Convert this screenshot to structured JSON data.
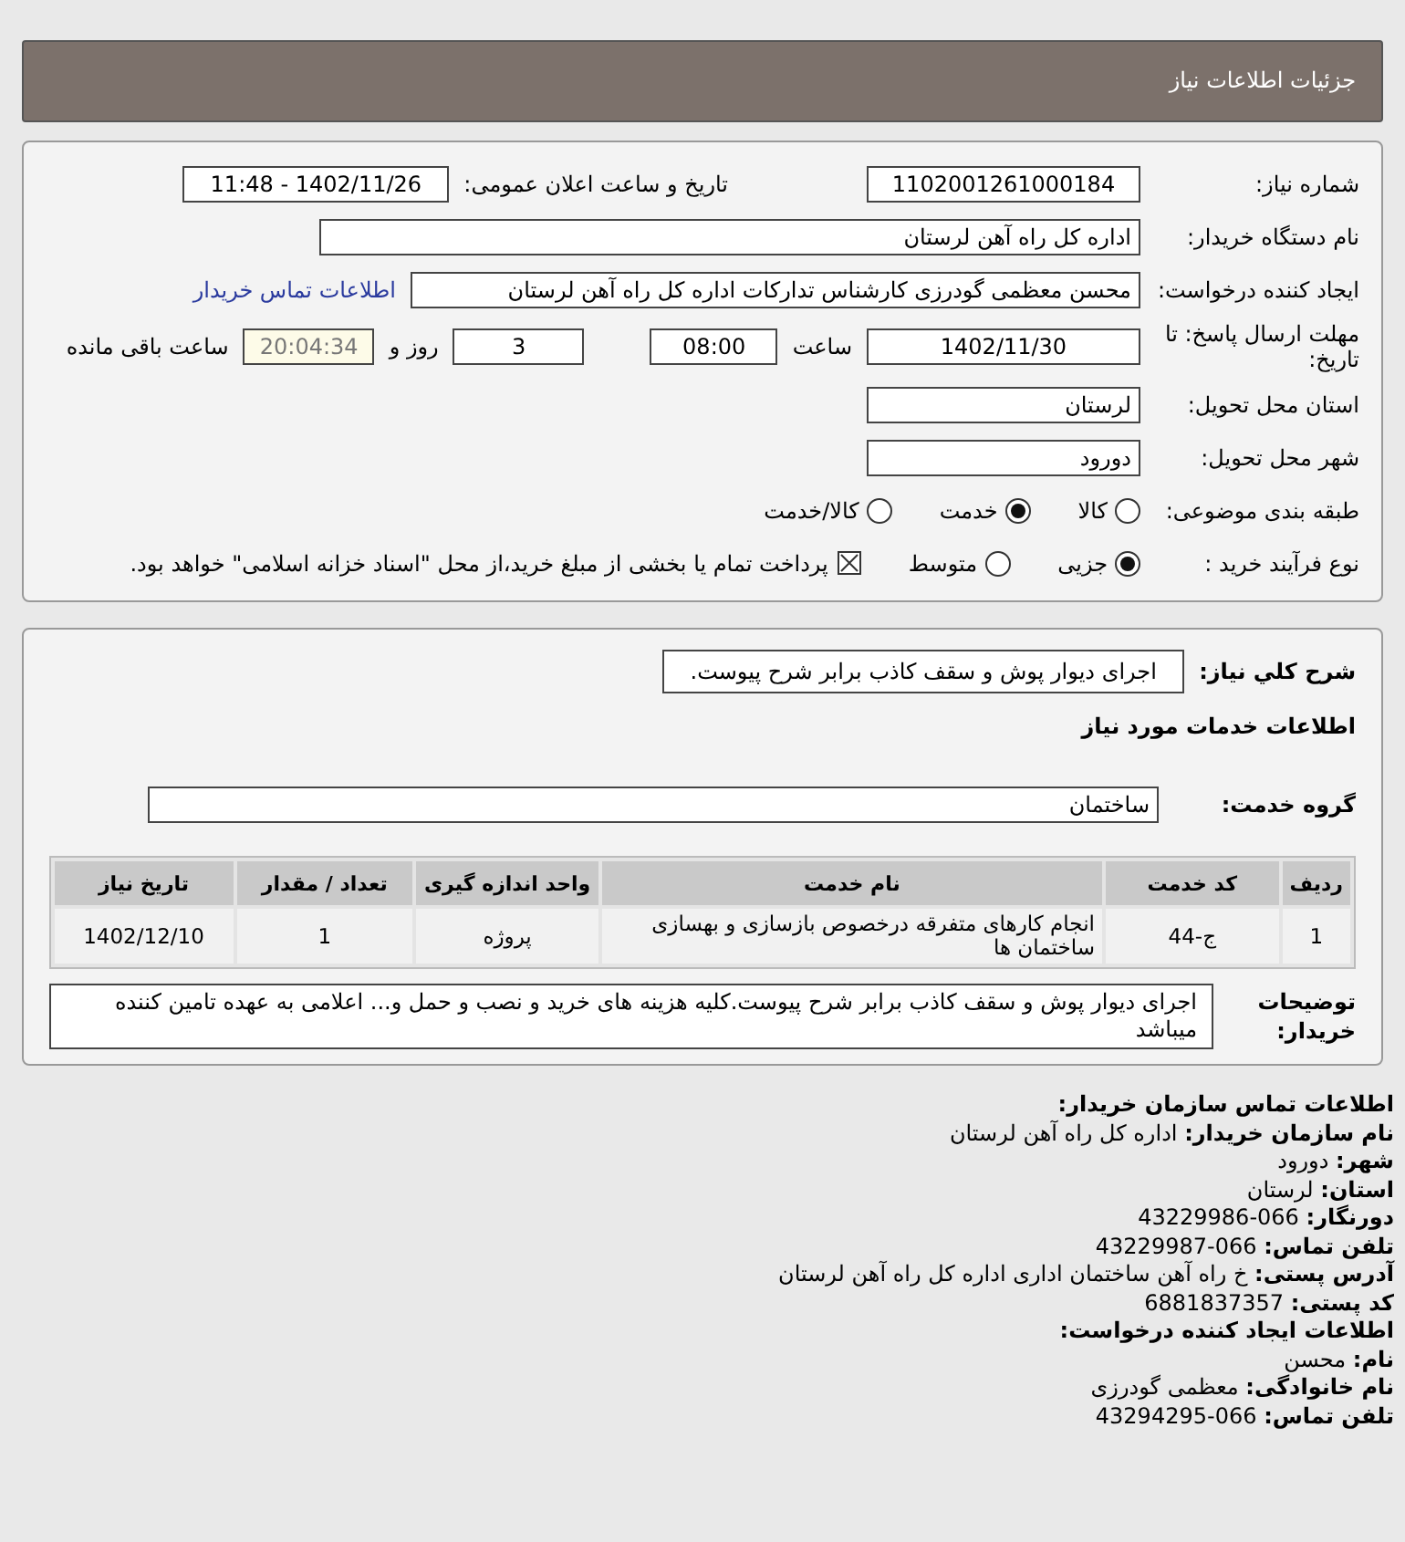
{
  "header": {
    "title": "جزئیات اطلاعات نیاز"
  },
  "need_number": {
    "label": "شماره نیاز:",
    "value": "1102001261000184"
  },
  "announce": {
    "label": "تاریخ و ساعت اعلان عمومی:",
    "value": "1402/11/26 - 11:48"
  },
  "buyer_org": {
    "label": "نام دستگاه خریدار:",
    "value": "اداره کل راه آهن لرستان"
  },
  "requester": {
    "label": "ایجاد کننده درخواست:",
    "value": "محسن معظمی گودرزی کارشناس تدارکات اداره کل راه آهن لرستان",
    "link": "اطلاعات تماس خریدار"
  },
  "deadline": {
    "label": "مهلت ارسال پاسخ: تا تاریخ:",
    "date": "1402/11/30",
    "time_label": "ساعت",
    "time": "08:00",
    "days": "3",
    "days_label": "روز و",
    "remaining": "20:04:34",
    "remaining_label": "ساعت باقی مانده"
  },
  "province": {
    "label": "استان محل تحویل:",
    "value": "لرستان"
  },
  "city": {
    "label": "شهر محل تحویل:",
    "value": "دورود"
  },
  "category": {
    "label": "طبقه بندی موضوعی:",
    "options": [
      {
        "label": "کالا",
        "selected": false
      },
      {
        "label": "خدمت",
        "selected": true
      },
      {
        "label": "کالا/خدمت",
        "selected": false
      }
    ]
  },
  "process": {
    "label": "نوع فرآیند خرید :",
    "options": [
      {
        "label": "جزیی",
        "selected": true
      },
      {
        "label": "متوسط",
        "selected": false
      }
    ],
    "payment": {
      "checked": true,
      "label": "پرداخت تمام یا بخشی از مبلغ خرید،از محل \"اسناد خزانه اسلامی\" خواهد بود."
    }
  },
  "description": {
    "label": "شرح كلي نياز:",
    "value": "اجرای دیوار پوش و سقف کاذب برابر شرح پیوست."
  },
  "services_title": "اطلاعات خدمات مورد نیاز",
  "service_group": {
    "label": "گروه خدمت:",
    "value": "ساختمان"
  },
  "table": {
    "columns": [
      "ردیف",
      "کد خدمت",
      "نام خدمت",
      "واحد اندازه گیری",
      "تعداد / مقدار",
      "تاریخ نیاز"
    ],
    "rows": [
      [
        "1",
        "ج-44",
        "انجام کارهای متفرقه درخصوص بازسازی و بهسازی ساختمان ها",
        "پروژه",
        "1",
        "1402/12/10"
      ]
    ]
  },
  "buyer_notes": {
    "label": "توضیحات خریدار:",
    "value": "اجرای دیوار پوش و سقف کاذب برابر شرح پیوست.کلیه هزینه های خرید و نصب و حمل و... اعلامی به عهده تامین کننده میباشد"
  },
  "contact": [
    {
      "kind": "heading",
      "text": "اطلاعات تماس سازمان خریدار:"
    },
    {
      "kind": "line",
      "text": "**نام سازمان خریدار:** اداره کل راه آهن لرستان"
    },
    {
      "kind": "line",
      "text": "**شهر:** دورود"
    },
    {
      "kind": "line",
      "text": "**استان:** لرستان"
    },
    {
      "kind": "line",
      "text": "**دورنگار:** 066-43229986"
    },
    {
      "kind": "line",
      "text": "**تلفن تماس:** 066-43229987"
    },
    {
      "kind": "line",
      "text": "**آدرس پستی:** خ راه آهن ساختمان اداری اداره کل راه آهن لرستان"
    },
    {
      "kind": "line",
      "text": "**کد پستی:** 6881837357"
    },
    {
      "kind": "heading",
      "text": "اطلاعات ایجاد کننده درخواست:"
    },
    {
      "kind": "line",
      "text": "**نام:** محسن"
    },
    {
      "kind": "line",
      "text": "**نام خانوادگی:** معظمی گودرزی"
    },
    {
      "kind": "line",
      "text": "**تلفن تماس:** 066-43294295"
    }
  ]
}
